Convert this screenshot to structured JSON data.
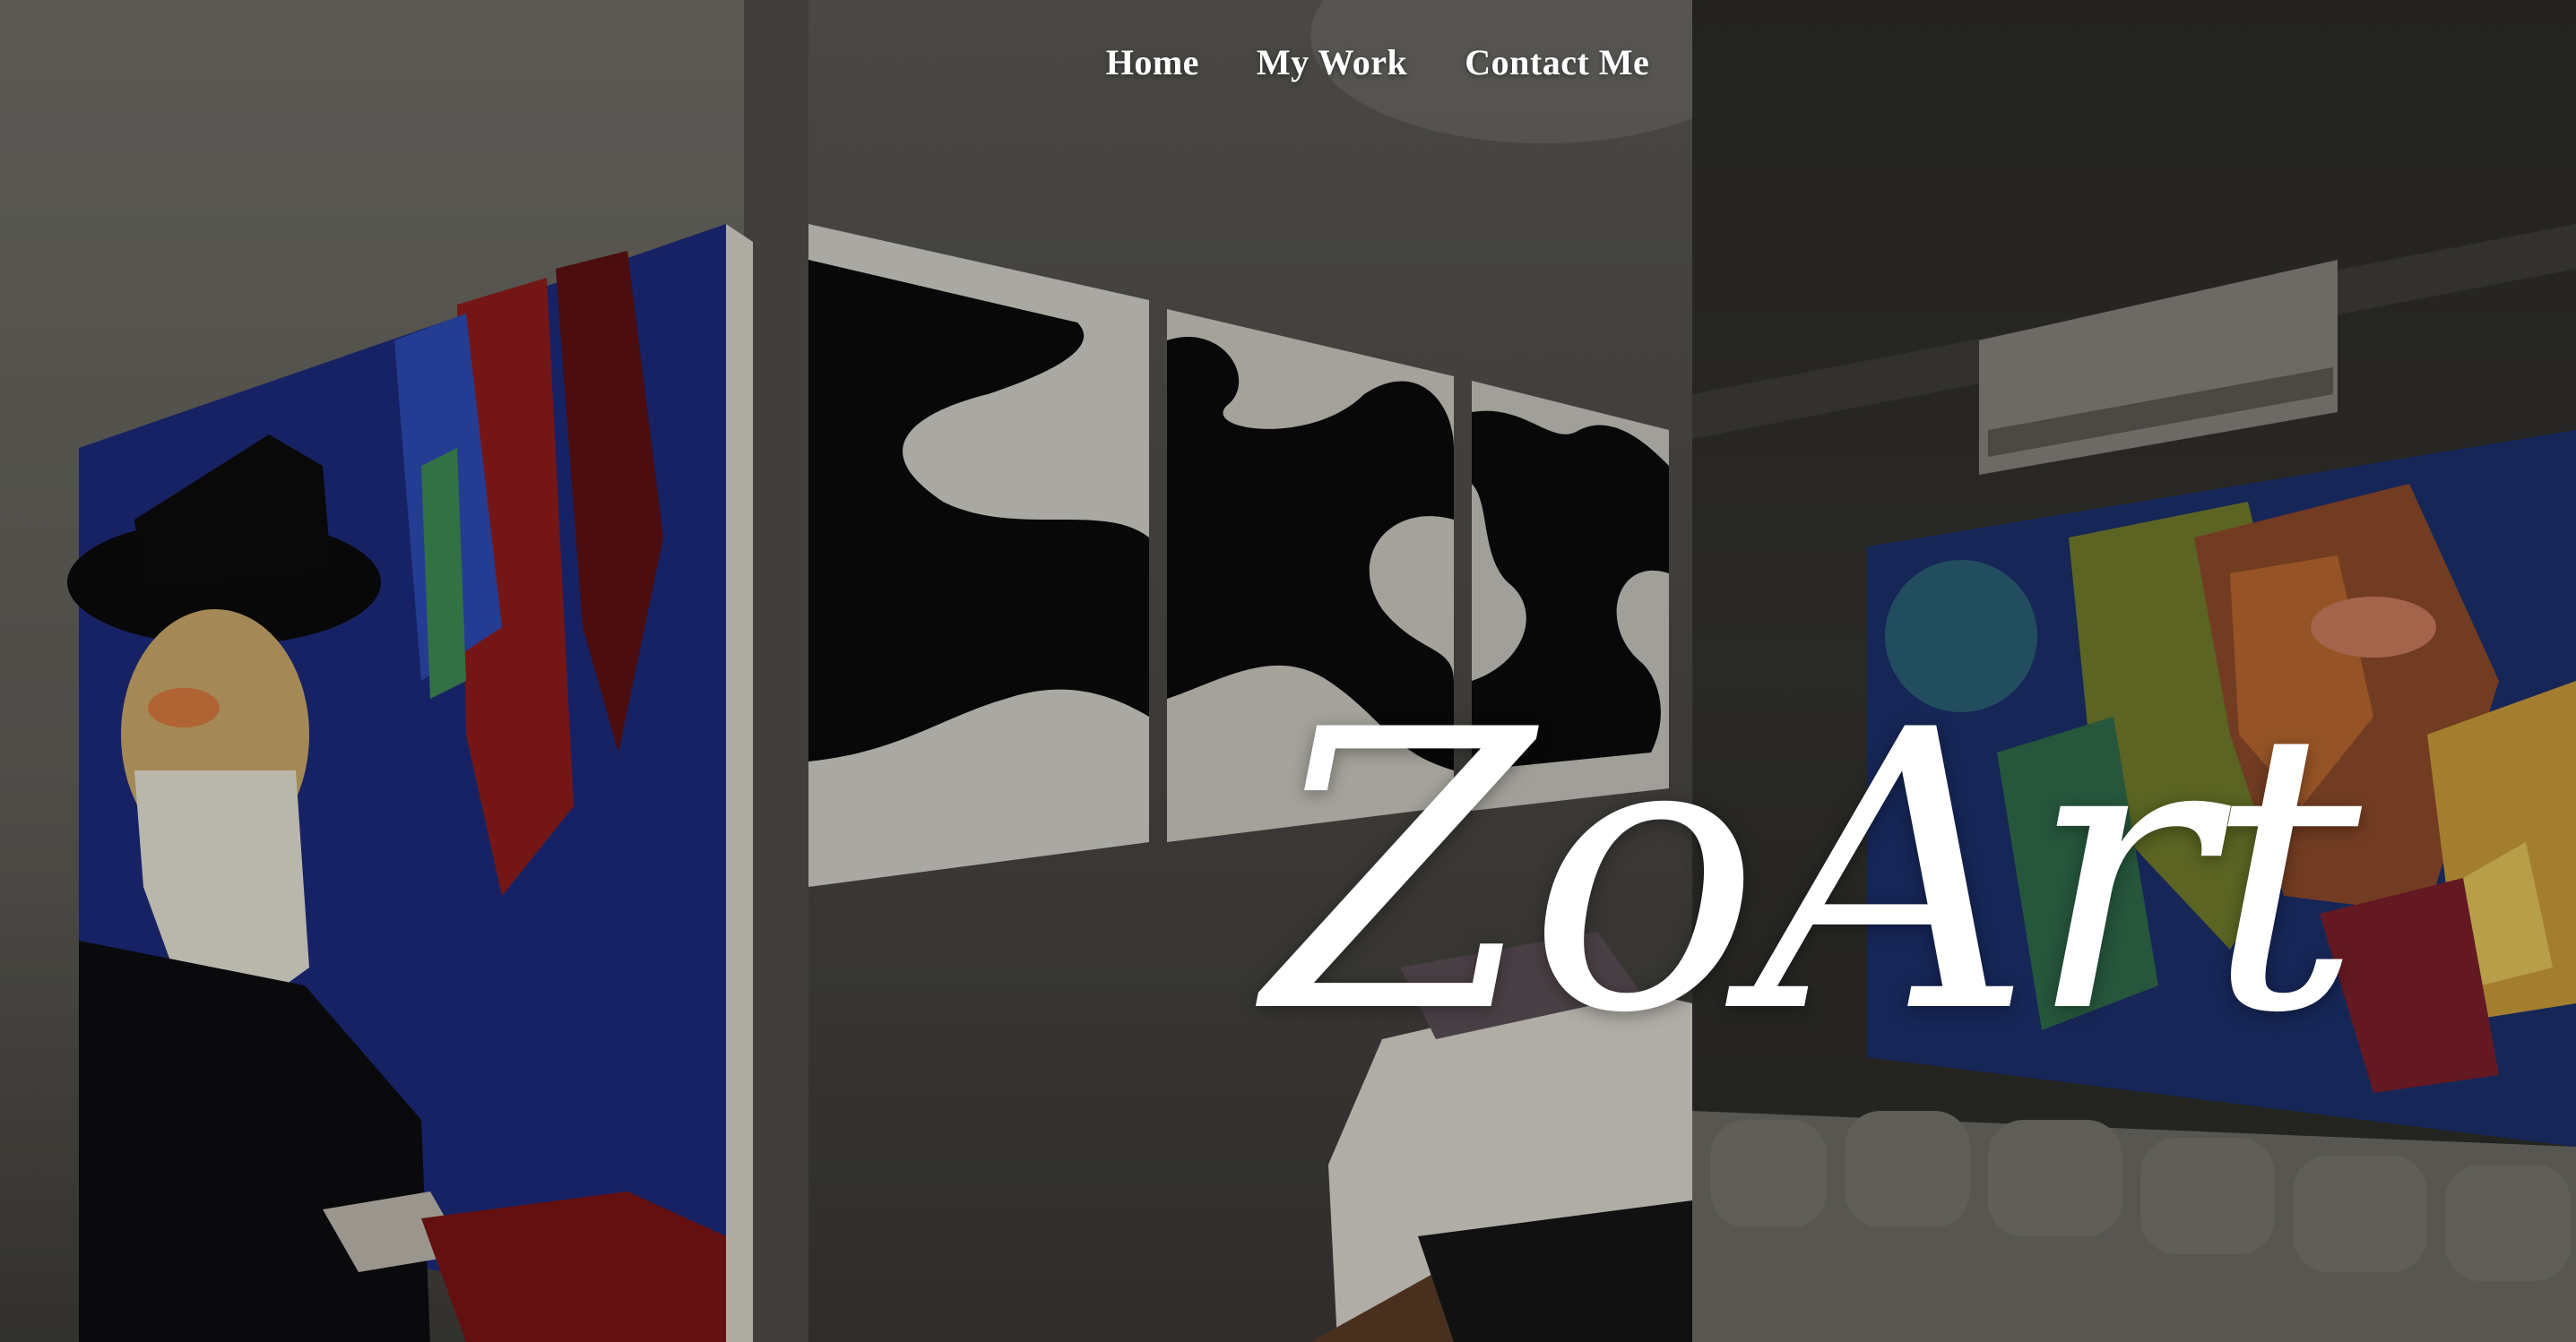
{
  "nav": {
    "items": [
      {
        "label": "Home"
      },
      {
        "label": "My Work"
      },
      {
        "label": "Contact Me"
      }
    ]
  },
  "hero": {
    "title": "ZoArt"
  },
  "images": {
    "left_panel": "portrait-painting-photo",
    "middle_panel": "abstract-triptych-photo",
    "right_panel": "abstract-face-painting-photo"
  },
  "colors": {
    "text": "#ffffff",
    "overlay": "#000000"
  }
}
